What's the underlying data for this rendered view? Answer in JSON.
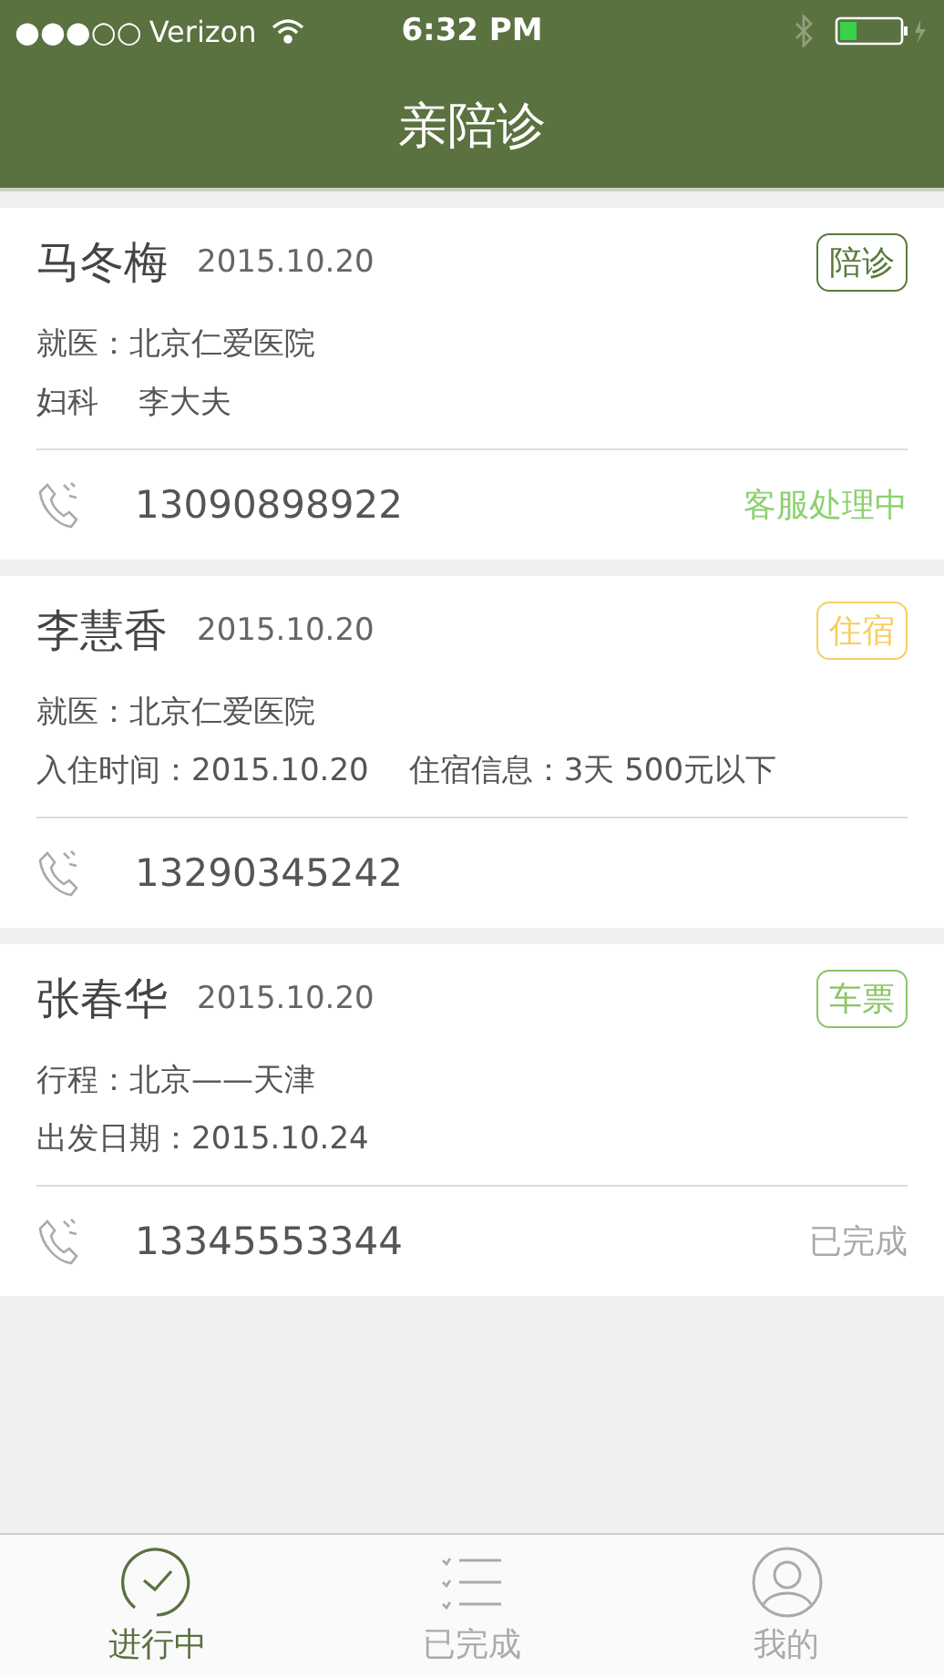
{
  "status_bar": {
    "signal": "●●●○○",
    "carrier": "Verizon",
    "time": "6:32 PM"
  },
  "nav": {
    "title": "亲陪诊"
  },
  "orders": [
    {
      "name": "马冬梅",
      "date": "2015.10.20",
      "tag": {
        "text": "陪诊",
        "color": "#5a7a3c"
      },
      "lines": [
        [
          "就医：北京仁爱医院"
        ],
        [
          "妇科",
          "李大夫"
        ]
      ],
      "phone": "13090898922",
      "status": {
        "text": "客服处理中",
        "color": "#8cd06e"
      }
    },
    {
      "name": "李慧香",
      "date": "2015.10.20",
      "tag": {
        "text": "住宿",
        "color": "#f5cf62"
      },
      "lines": [
        [
          "就医：北京仁爱医院"
        ],
        [
          "入住时间：2015.10.20",
          "住宿信息：3天  500元以下"
        ]
      ],
      "phone": "13290345242"
    },
    {
      "name": "张春华",
      "date": "2015.10.20",
      "tag": {
        "text": "车票",
        "color": "#8cc466"
      },
      "lines": [
        [
          "行程：北京——天津"
        ],
        [
          "出发日期：2015.10.24"
        ]
      ],
      "phone": "13345553344",
      "status": {
        "text": "已完成",
        "color": "#a9a9a9"
      }
    }
  ],
  "tabs": [
    {
      "kind": "clock",
      "label": "进行中",
      "selected": true
    },
    {
      "kind": "list",
      "label": "已完成",
      "selected": false
    },
    {
      "kind": "user",
      "label": "我的",
      "selected": false
    }
  ]
}
